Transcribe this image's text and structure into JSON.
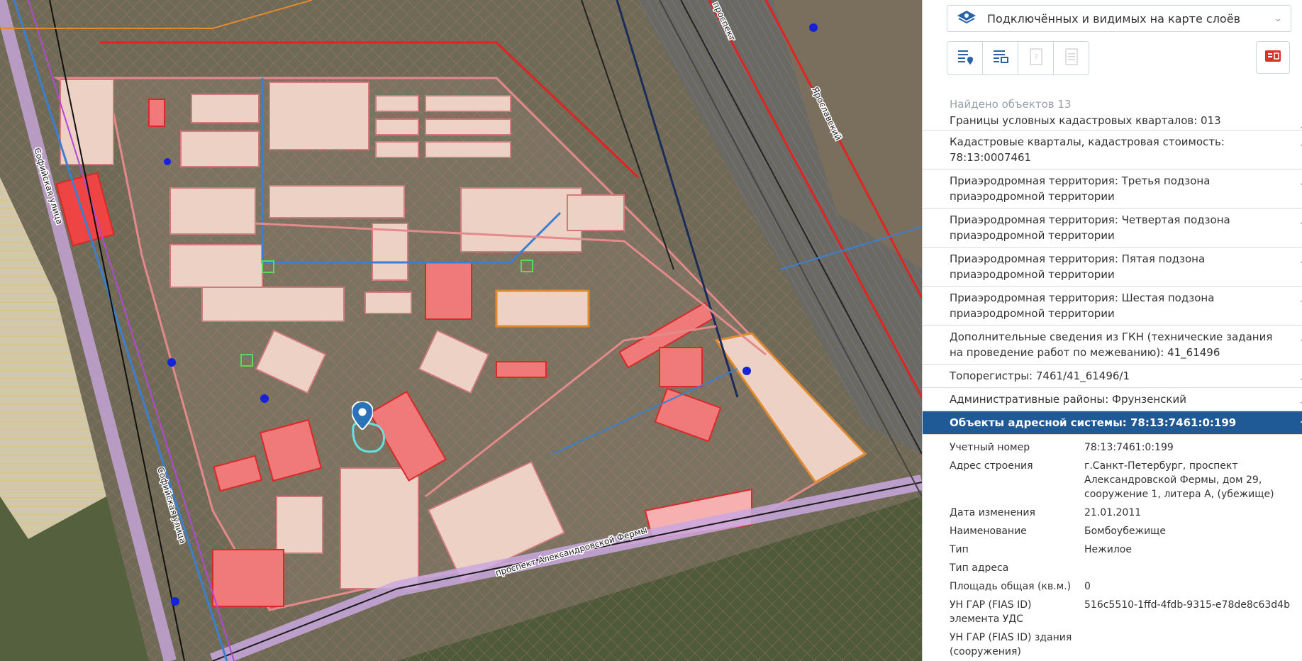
{
  "layer_selector": {
    "label": "Подключённых и видимых на карте слоёв"
  },
  "toolbar": {
    "buttons": [
      {
        "icon": "list-marker-icon",
        "state": "enabled"
      },
      {
        "icon": "list-tree-icon",
        "state": "enabled"
      },
      {
        "icon": "question-doc-icon",
        "state": "disabled"
      },
      {
        "icon": "document-icon",
        "state": "disabled"
      }
    ],
    "export_icon": "export-red-icon",
    "accent_color": "#d9312b"
  },
  "results": {
    "found_text": "Найдено объектов 13",
    "items": [
      {
        "label": "Границы условных кадастровых кварталов: 013"
      },
      {
        "label": "Кадастровые кварталы, кадастровая стоимость: 78:13:0007461"
      },
      {
        "label": "Приаэродромная территория: Третья подзона приаэродромной территории"
      },
      {
        "label": "Приаэродромная территория: Четвертая подзона приаэродромной территории"
      },
      {
        "label": "Приаэродромная территория: Пятая подзона приаэродромной территории"
      },
      {
        "label": "Приаэродромная территория: Шестая подзона приаэродромной территории"
      },
      {
        "label": "Дополнительные сведения из ГКН (технические задания на проведение работ по межеванию): 41_61496"
      },
      {
        "label": "Топорегистры: 7461/41_61496/1"
      },
      {
        "label": "Административные районы: Фрунзенский"
      },
      {
        "label": "Объекты адресной системы: 78:13:7461:0:199"
      }
    ],
    "active_color": "#1f5a96"
  },
  "details": [
    {
      "label": "Учетный номер",
      "value": "78:13:7461:0:199"
    },
    {
      "label": "Адрес строения",
      "value": "г.Санкт-Петербург, проспект Александровской Фермы, дом 29, сооружение 1, литера А, (убежище)"
    },
    {
      "label": "Дата изменения",
      "value": "21.01.2011"
    },
    {
      "label": "Наименование",
      "value": "Бомбоубежище"
    },
    {
      "label": "Тип",
      "value": "Нежилое"
    },
    {
      "label": "Тип адреса",
      "value": ""
    },
    {
      "label": "Площадь общая (кв.м.)",
      "value": "0"
    },
    {
      "label": "УН ГАР (FIAS ID) элемента УДС",
      "value": "516c5510-1ffd-4fdb-9315-e78de8c63d4b"
    },
    {
      "label": "УН ГАР (FIAS ID) здания (сооружения)",
      "value": ""
    }
  ],
  "map": {
    "streets": [
      "проспект Александровской Фермы",
      "Софийская улица",
      "проспект",
      "Ярославский"
    ],
    "marker_icon": "location-pin-icon",
    "colors": {
      "parcel": "#e8a0a0",
      "building": "#f08a8a",
      "boundary_red": "#e32222",
      "boundary_blue": "#3a7fd0",
      "boundary_purple": "#b04ad6",
      "boundary_orange": "#e08a30"
    }
  }
}
